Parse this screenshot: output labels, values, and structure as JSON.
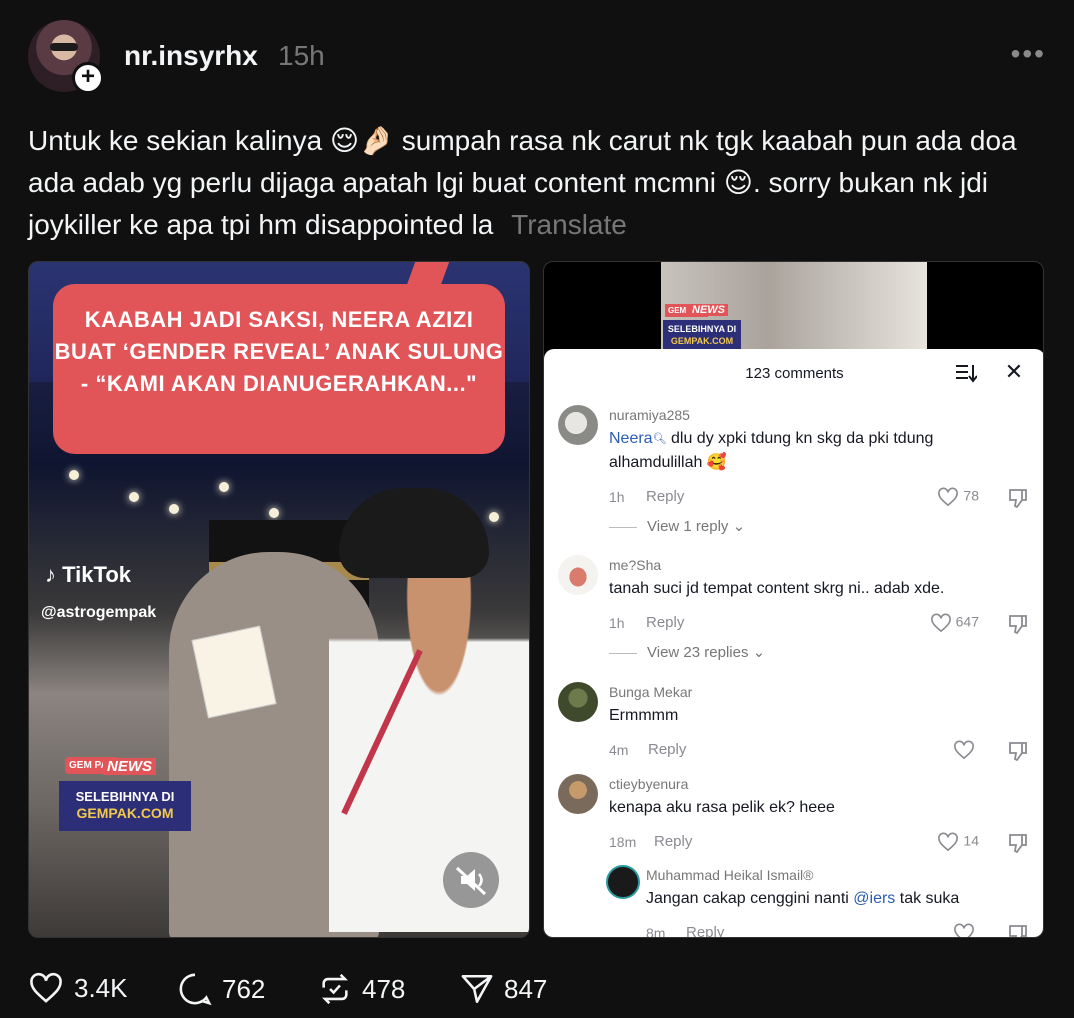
{
  "post": {
    "username": "nr.insyrhx",
    "time": "15h",
    "more": "•••",
    "text": "Untuk ke sekian kalinya 😌🤌🏻 sumpah rasa nk carut nk tgk kaabah pun ada doa ada adab yg perlu dijaga apatah lgi buat content mcmni 😌. sorry bukan nk jdi joykiller ke apa tpi hm disappointed la",
    "translate": "Translate"
  },
  "left_media": {
    "headline": "KAABAH JADI SAKSI, NEERA AZIZI BUAT ‘GENDER REVEAL’ ANAK SULUNG - “KAMI AKAN DIANUGERAHKAN...\"",
    "tiktok": "TikTok",
    "handle": "@astrogempak",
    "gempak_logo": "GEM PAK",
    "news": "NEWS",
    "box_line1": "SELEBIHNYA DI",
    "box_line2": "GEMPAK.COM"
  },
  "right_media": {
    "news": "NEWS",
    "gempak_logo": "GEM PAK",
    "box_line1": "SELEBIHNYA DI",
    "box_line2": "GEMPAK.COM",
    "panel_title": "123 comments",
    "close": "✕",
    "comments": [
      {
        "name": "nuramiya285",
        "mention": "Neera",
        "text": " dlu dy xpki tdung kn skg da pki tdung alhamdulillah 🥰",
        "time": "1h",
        "reply": "Reply",
        "likes": "78",
        "view": "View 1 reply ⌄"
      },
      {
        "name": "me?Sha",
        "text": "tanah suci jd tempat content skrg ni.. adab xde.",
        "time": "1h",
        "reply": "Reply",
        "likes": "647",
        "view": "View 23 replies ⌄"
      },
      {
        "name": "Bunga Mekar",
        "text": "Ermmmm",
        "time": "4m",
        "reply": "Reply",
        "likes": ""
      },
      {
        "name": "ctieybyenura",
        "text": "kenapa aku rasa pelik ek? heee",
        "time": "18m",
        "reply": "Reply",
        "likes": "14"
      },
      {
        "name": "Muhammad Heikal Ismail®",
        "text_before": "Jangan cakap cenggini nanti ",
        "mention": "@iers",
        "text_after": " tak suka",
        "time": "8m",
        "reply": "Reply"
      }
    ]
  },
  "actions": {
    "likes": "3.4K",
    "comments": "762",
    "reposts": "478",
    "shares": "847"
  }
}
